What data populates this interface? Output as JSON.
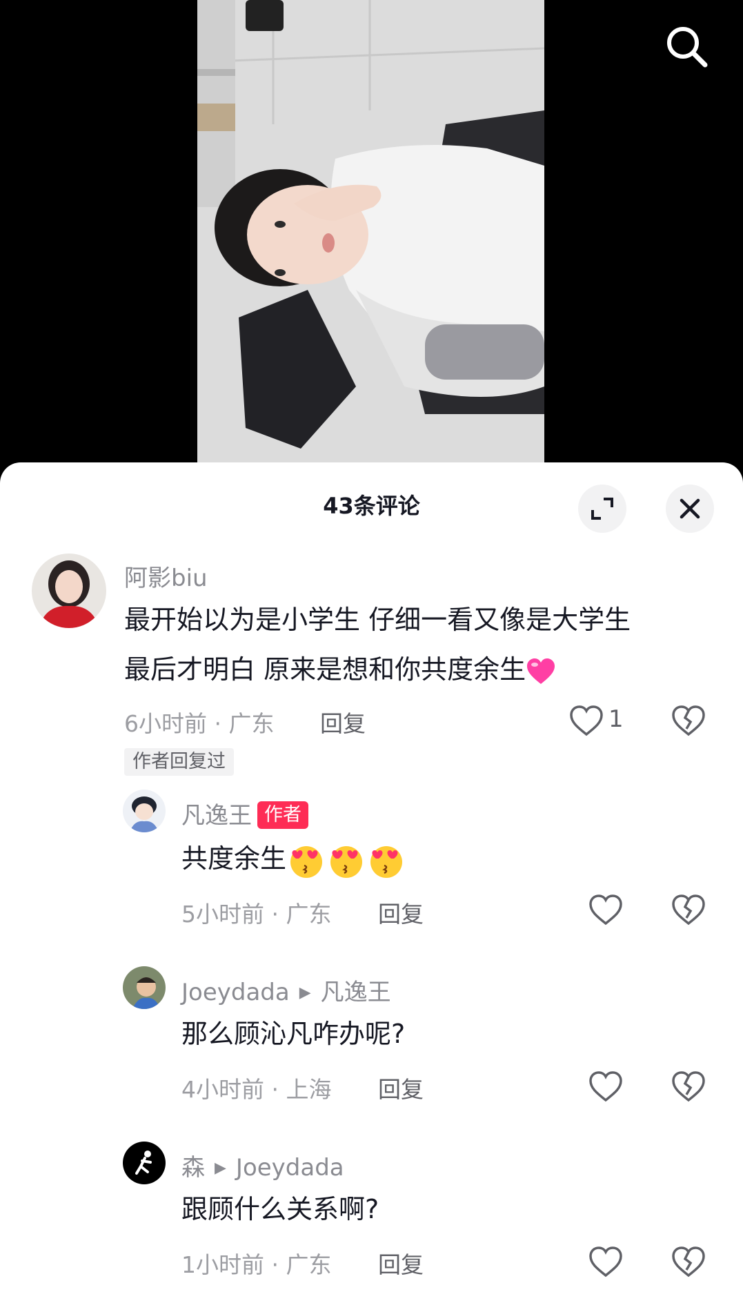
{
  "header": {
    "search_icon": "search-icon"
  },
  "sheet": {
    "title": "43条评论",
    "expand_icon": "expand-icon",
    "close_icon": "close-icon"
  },
  "comments": [
    {
      "username": "阿影biu",
      "line1": "最开始以为是小学生 仔细一看又像是大学生",
      "line2": "最后才明白 原来是想和你共度余生",
      "line2_emoji": "pink-heart-emoji",
      "time_location": "6小时前 · 广东",
      "reply_label": "回复",
      "like_count": "1",
      "author_replied": "作者回复过"
    }
  ],
  "replies": [
    {
      "username": "凡逸王",
      "badge": "作者",
      "text": "共度余生",
      "emojis": [
        "heart-eyes-kiss-emoji",
        "heart-eyes-kiss-emoji",
        "heart-eyes-kiss-emoji"
      ],
      "time_location": "5小时前 · 广东",
      "reply_label": "回复"
    },
    {
      "username": "Joeydada",
      "reply_to": "凡逸王",
      "text": "那么顾沁凡咋办呢?",
      "time_location": "4小时前 · 上海",
      "reply_label": "回复"
    },
    {
      "username": "森",
      "reply_to": "Joeydada",
      "text": "跟顾什么关系啊?",
      "time_location": "1小时前 · 广东",
      "reply_label": "回复"
    }
  ],
  "colors": {
    "accent": "#fe2c55",
    "text": "#161823",
    "muted": "#8a8b91"
  }
}
